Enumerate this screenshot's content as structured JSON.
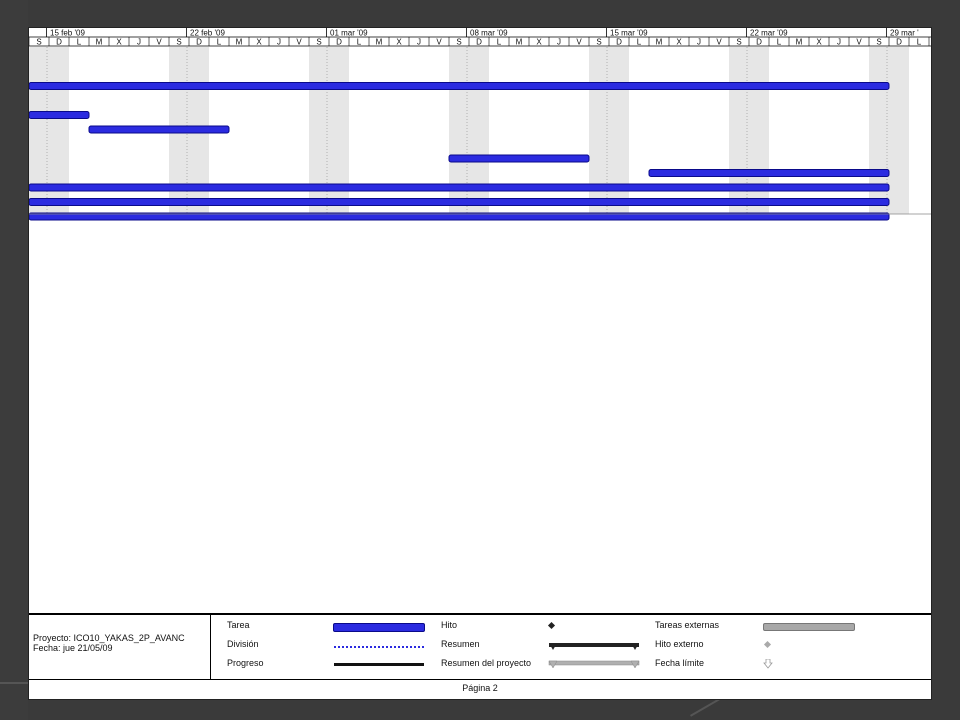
{
  "chart_data": {
    "type": "gantt",
    "week_labels": [
      "15 feb '09",
      "22 feb '09",
      "01 mar '09",
      "08 mar '09",
      "15 mar '09",
      "22 mar '09",
      "29 mar '"
    ],
    "day_letters": [
      "S",
      "D",
      "L",
      "M",
      "X",
      "J",
      "V"
    ],
    "bars": [
      {
        "row": 0,
        "start": "2009-02-14",
        "end": "2009-03-29"
      },
      {
        "row": 2,
        "start": "2009-02-14",
        "end": "2009-02-17"
      },
      {
        "row": 3,
        "start": "2009-02-17",
        "end": "2009-02-24"
      },
      {
        "row": 5,
        "start": "2009-03-07",
        "end": "2009-03-14"
      },
      {
        "row": 6,
        "start": "2009-03-17",
        "end": "2009-03-29"
      },
      {
        "row": 7,
        "start": "2009-02-14",
        "end": "2009-03-29"
      },
      {
        "row": 8,
        "start": "2009-02-14",
        "end": "2009-03-29"
      },
      {
        "row": 9,
        "start": "2009-02-14",
        "end": "2009-03-29"
      }
    ],
    "colors": {
      "task": "#2b2be0",
      "task_edge": "#0a0a8a",
      "weekend": "#e6e6e6",
      "progress": "#111111",
      "summary": "#333333",
      "project_summary": "#a8a8a8",
      "external": "#a0a0a0"
    }
  },
  "legend": {
    "project": "Proyecto: ICO10_YAKAS_2P_AVANC",
    "date": "Fecha: jue 21/05/09",
    "items": {
      "tarea": "Tarea",
      "division": "División",
      "progreso": "Progreso",
      "hito": "Hito",
      "resumen": "Resumen",
      "resumen_proyecto": "Resumen del proyecto",
      "tareas_externas": "Tareas externas",
      "hito_externo": "Hito externo",
      "fecha_limite": "Fecha límite"
    }
  },
  "footer": {
    "page": "Página 2"
  }
}
